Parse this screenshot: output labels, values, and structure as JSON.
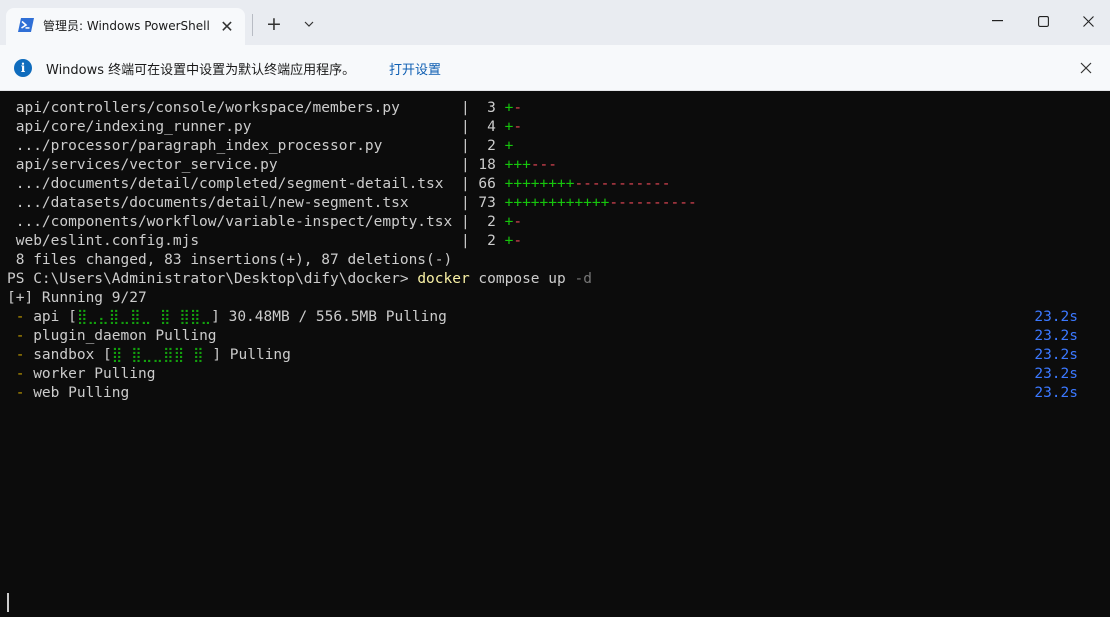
{
  "window": {
    "tab_title": "管理员: Windows PowerShell",
    "newtab_glyph": "+",
    "close_glyph": "✕"
  },
  "infobar": {
    "message": "Windows 终端可在设置中设置为默认终端应用程序。",
    "link": "打开设置"
  },
  "terminal": {
    "diffstat": [
      {
        "path": " api/controllers/console/workspace/members.py       ",
        "sep": "|",
        "count": "  3 ",
        "plus": "+",
        "minus": "-"
      },
      {
        "path": " api/core/indexing_runner.py                        ",
        "sep": "|",
        "count": "  4 ",
        "plus": "+",
        "minus": "-"
      },
      {
        "path": " .../processor/paragraph_index_processor.py         ",
        "sep": "|",
        "count": "  2 ",
        "plus": "+",
        "minus": ""
      },
      {
        "path": " api/services/vector_service.py                     ",
        "sep": "|",
        "count": " 18 ",
        "plus": "+++",
        "minus": "---"
      },
      {
        "path": " .../documents/detail/completed/segment-detail.tsx  ",
        "sep": "|",
        "count": " 66 ",
        "plus": "++++++++",
        "minus": "-----------"
      },
      {
        "path": " .../datasets/documents/detail/new-segment.tsx      ",
        "sep": "|",
        "count": " 73 ",
        "plus": "++++++++++++",
        "minus": "----------"
      },
      {
        "path": " .../components/workflow/variable-inspect/empty.tsx ",
        "sep": "|",
        "count": "  2 ",
        "plus": "+",
        "minus": "-"
      },
      {
        "path": " web/eslint.config.mjs                              ",
        "sep": "|",
        "count": "  2 ",
        "plus": "+",
        "minus": "-"
      }
    ],
    "summary": " 8 files changed, 83 insertions(+), 87 deletions(-)",
    "prompt": "PS C:\\Users\\Administrator\\Desktop\\dify\\docker> ",
    "cmd_name": "docker",
    "cmd_args": " compose up ",
    "cmd_flag": "-d",
    "running": "[+] Running 9/27",
    "services": [
      {
        "dash": " - ",
        "pre": "api [",
        "bar": "⣿⣀⣄⣿⣀⣿⣀ ⣿ ⣿⣿⣀",
        "post": "] 30.48MB / 556.5MB Pulling",
        "time": "23.2s"
      },
      {
        "dash": " - ",
        "pre": "plugin_daemon Pulling",
        "bar": "",
        "post": "",
        "time": "23.2s"
      },
      {
        "dash": " - ",
        "pre": "sandbox [",
        "bar": "⣿ ⣿⣀⣀⣿⣿ ⣿ ",
        "post": "] Pulling",
        "time": "23.2s"
      },
      {
        "dash": " - ",
        "pre": "worker Pulling",
        "bar": "",
        "post": "",
        "time": "23.2s"
      },
      {
        "dash": " - ",
        "pre": "web Pulling",
        "bar": "",
        "post": "",
        "time": "23.2s"
      }
    ]
  },
  "colors": {
    "terminal_bg": "#0c0c0c",
    "text": "#cccccc",
    "add": "#16c60c",
    "del": "#e74856",
    "command": "#f9f1a5",
    "dash": "#c19c00",
    "timer": "#3b78ff",
    "link": "#0f5fb3"
  }
}
